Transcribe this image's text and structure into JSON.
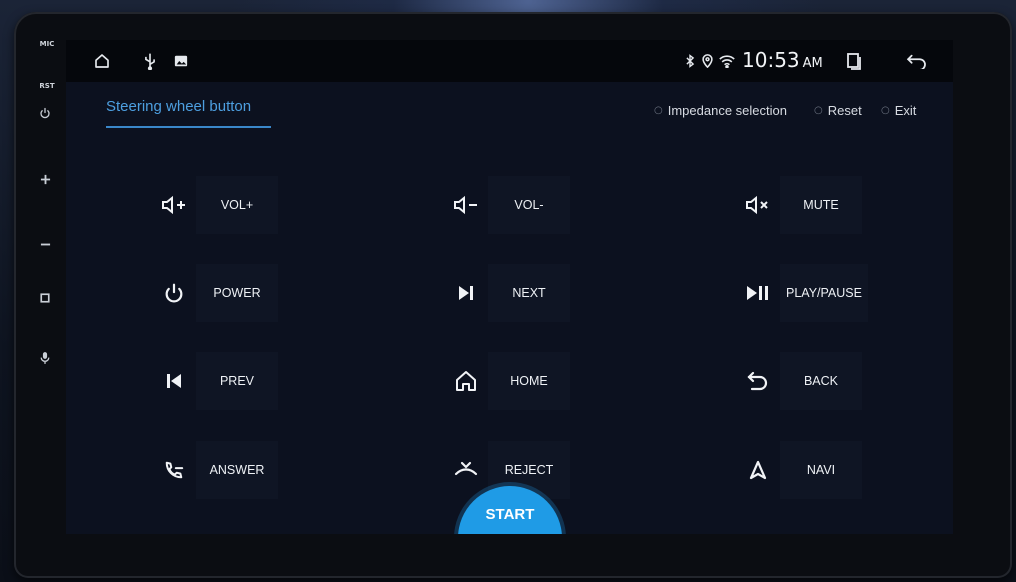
{
  "device": {
    "side_labels": {
      "mic": "MIC",
      "rst": "RST"
    },
    "side_icons": [
      "power-icon",
      "plus-icon",
      "minus-icon",
      "square-icon",
      "microphone-icon"
    ]
  },
  "statusbar": {
    "left_icons": [
      "home-icon",
      "usb-icon",
      "image-icon"
    ],
    "right_icons": [
      "bluetooth-icon",
      "location-icon",
      "wifi-icon"
    ],
    "time": "10:53",
    "ampm": "AM",
    "extra_icons": [
      "recent-apps-icon",
      "back-icon"
    ]
  },
  "header": {
    "title": "Steering wheel button",
    "actions": {
      "impedance": "Impedance selection",
      "reset": "Reset",
      "exit": "Exit"
    }
  },
  "keys": [
    {
      "icon": "volume-up-icon",
      "label": "VOL+"
    },
    {
      "icon": "volume-down-icon",
      "label": "VOL-"
    },
    {
      "icon": "mute-icon",
      "label": "MUTE"
    },
    {
      "icon": "power-icon",
      "label": "POWER"
    },
    {
      "icon": "next-track-icon",
      "label": "NEXT"
    },
    {
      "icon": "play-pause-icon",
      "label": "PLAY/PAUSE"
    },
    {
      "icon": "previous-track-icon",
      "label": "PREV"
    },
    {
      "icon": "home-icon",
      "label": "HOME"
    },
    {
      "icon": "back-arrow-icon",
      "label": "BACK"
    },
    {
      "icon": "answer-call-icon",
      "label": "ANSWER"
    },
    {
      "icon": "reject-call-icon",
      "label": "REJECT"
    },
    {
      "icon": "navigation-icon",
      "label": "NAVI"
    }
  ],
  "start_button": {
    "label": "START",
    "color": "#1f9be6"
  },
  "colors": {
    "accent": "#4d9fe0",
    "background": "#0c111f"
  }
}
